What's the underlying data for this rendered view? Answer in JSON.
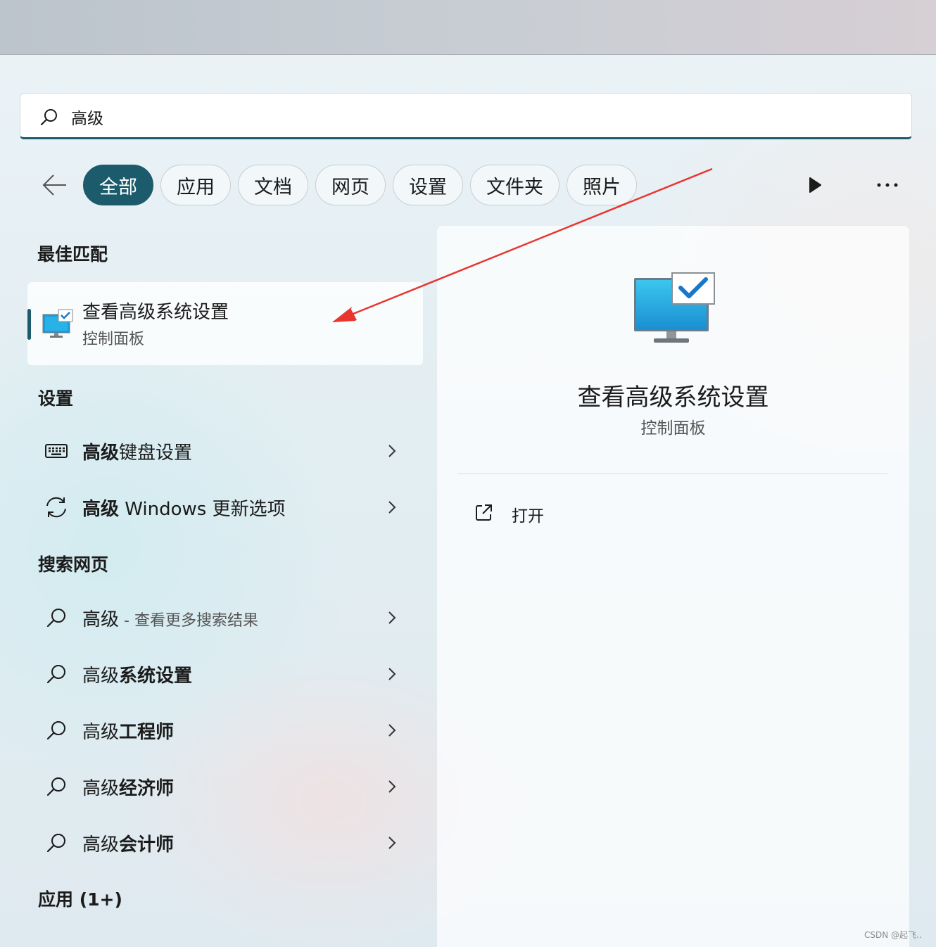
{
  "search": {
    "query": "高级"
  },
  "filters": [
    {
      "label": "全部",
      "active": true
    },
    {
      "label": "应用",
      "active": false
    },
    {
      "label": "文档",
      "active": false
    },
    {
      "label": "网页",
      "active": false
    },
    {
      "label": "设置",
      "active": false
    },
    {
      "label": "文件夹",
      "active": false
    },
    {
      "label": "照片",
      "active": false
    }
  ],
  "sections": {
    "best_match": "最佳匹配",
    "settings": "设置",
    "web": "搜索网页",
    "apps": "应用 (1+)"
  },
  "best_match": {
    "title": "查看高级系统设置",
    "subtitle": "控制面板",
    "icon": "system-properties-icon"
  },
  "settings_items": [
    {
      "bold": "高级",
      "rest": "键盘设置",
      "icon": "keyboard-icon"
    },
    {
      "bold": "高级",
      "rest": " Windows 更新选项",
      "icon": "sync-icon"
    }
  ],
  "web_items": [
    {
      "normal": "高级",
      "bold": "",
      "sub": " - 查看更多搜索结果"
    },
    {
      "normal": "高级",
      "bold": "系统设置",
      "sub": ""
    },
    {
      "normal": "高级",
      "bold": "工程师",
      "sub": ""
    },
    {
      "normal": "高级",
      "bold": "经济师",
      "sub": ""
    },
    {
      "normal": "高级",
      "bold": "会计师",
      "sub": ""
    }
  ],
  "details": {
    "title": "查看高级系统设置",
    "subtitle": "控制面板",
    "action": "打开"
  },
  "watermark": "CSDN @起飞..",
  "colors": {
    "accent": "#1c5b6b",
    "annotation_arrow": "#e8362f"
  }
}
